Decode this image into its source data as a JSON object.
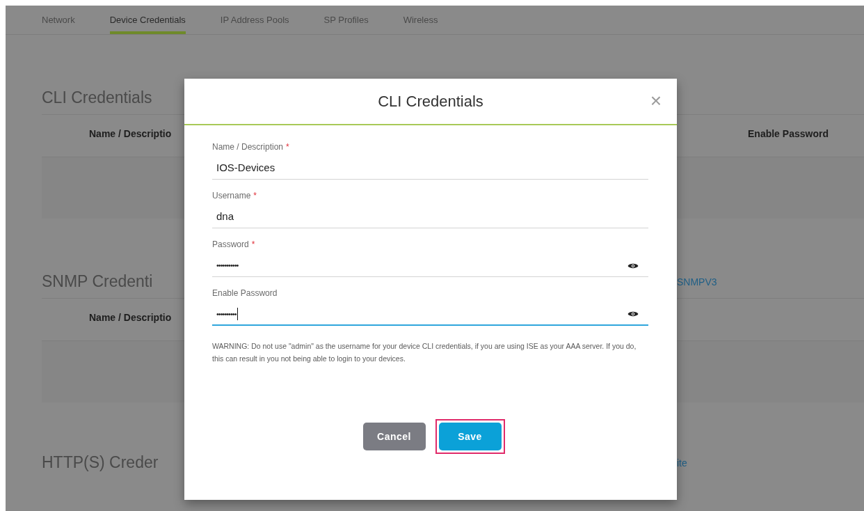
{
  "tabs": [
    {
      "label": "Network",
      "selected": false
    },
    {
      "label": "Device Credentials",
      "selected": true
    },
    {
      "label": "IP Address Pools",
      "selected": false
    },
    {
      "label": "SP Profiles",
      "selected": false
    },
    {
      "label": "Wireless",
      "selected": false
    }
  ],
  "sections": [
    {
      "title": "CLI Credentials",
      "columns": [
        "Name / Descriptio",
        "Enable Password"
      ]
    },
    {
      "title": "SNMP Credenti",
      "columns": [
        "Name / Descriptio"
      ],
      "link": "SNMPV3"
    },
    {
      "title": "HTTP(S) Creder",
      "link": "ite"
    }
  ],
  "dialog": {
    "title": "CLI Credentials",
    "close": "×",
    "fields": [
      {
        "label": "Name / Description",
        "required_mark": "*",
        "value": "IOS-Devices",
        "kind": "text",
        "focused": false
      },
      {
        "label": "Username",
        "required_mark": "*",
        "value": "dna",
        "kind": "text",
        "focused": false
      },
      {
        "label": "Password",
        "required_mark": "*",
        "value": "•••••••••••",
        "kind": "password",
        "focused": false
      },
      {
        "label": "Enable Password",
        "value": "••••••••••",
        "kind": "password",
        "focused": true
      }
    ],
    "warning": "WARNING: Do not use \"admin\" as the username for your device CLI credentials, if you are using ISE as your AAA server. If you do, this can result in you not being able to login to your devices.",
    "buttons": [
      {
        "label": "Cancel",
        "kind": "secondary",
        "highlighted": false
      },
      {
        "label": "Save",
        "kind": "primary",
        "highlighted": true
      }
    ]
  }
}
